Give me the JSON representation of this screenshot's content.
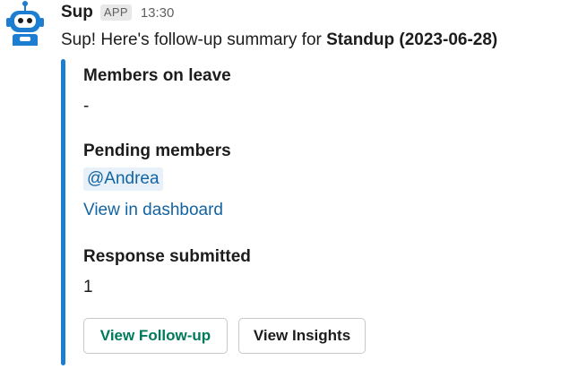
{
  "message": {
    "sender": "Sup",
    "badge": "APP",
    "time": "13:30",
    "intro_prefix": "Sup! Here's follow-up summary for ",
    "intro_bold": "Standup (2023-06-28)"
  },
  "attachment": {
    "accent_color": "#1d7ed1",
    "members_on_leave": {
      "title": "Members on leave",
      "value": "-"
    },
    "pending_members": {
      "title": "Pending members",
      "mention": "@Andrea",
      "link": "View in dashboard"
    },
    "response_submitted": {
      "title": "Response submitted",
      "value": "1"
    },
    "buttons": {
      "follow_up": "View Follow-up",
      "insights": "View Insights"
    }
  },
  "icons": {
    "avatar": "robot-icon"
  },
  "colors": {
    "link": "#1264a3",
    "primary_button_text": "#007a5a",
    "avatar_blue": "#1d7ed1"
  }
}
